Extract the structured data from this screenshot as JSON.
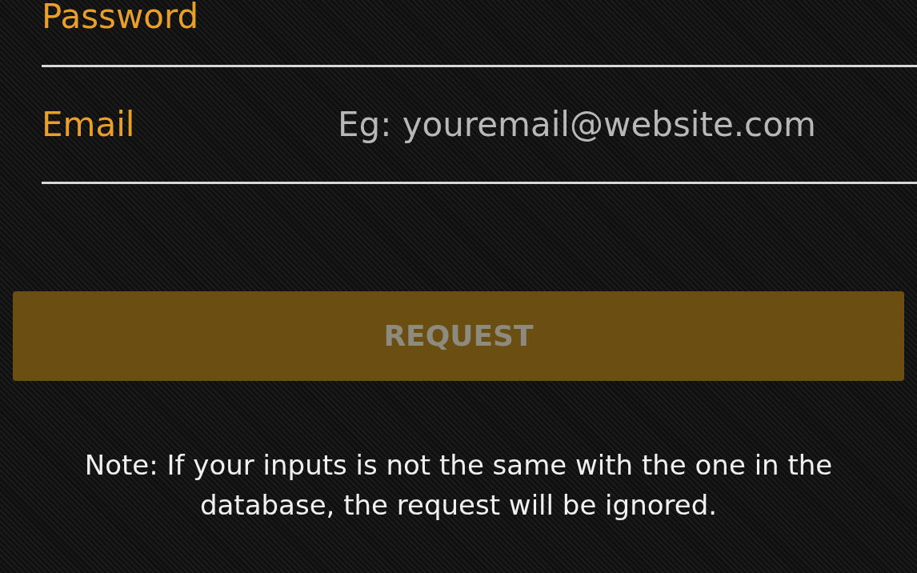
{
  "form": {
    "fields": [
      {
        "label": "Password"
      },
      {
        "label": "Email",
        "placeholder": "Eg: youremail@website.com"
      }
    ]
  },
  "request_button": {
    "label": "REQUEST",
    "disabled": true
  },
  "note": "Note: If your inputs is not the same with the one in the database, the request will be ignored."
}
